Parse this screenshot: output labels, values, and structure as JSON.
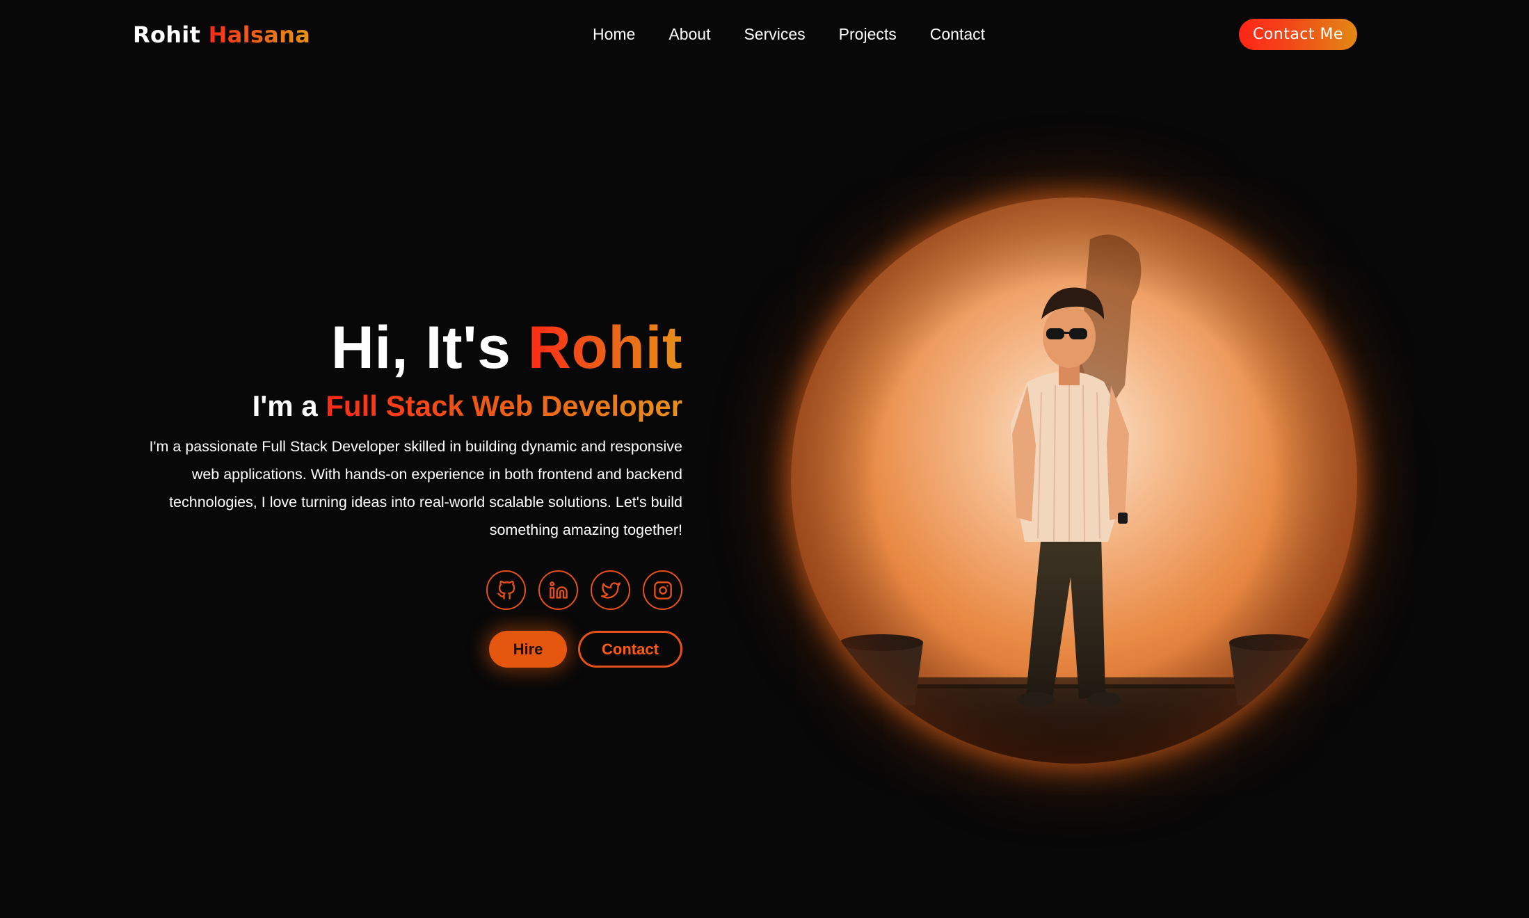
{
  "navbar": {
    "logo_first": "Rohit",
    "logo_last": "Halsana",
    "links": [
      {
        "label": "Home"
      },
      {
        "label": "About"
      },
      {
        "label": "Services"
      },
      {
        "label": "Projects"
      },
      {
        "label": "Contact"
      }
    ],
    "cta_label": "Contact Me"
  },
  "hero": {
    "greeting": "Hi, It's ",
    "name": "Rohit",
    "role_prefix": "I'm a ",
    "role": "Full Stack Web Developer",
    "description": "I'm a passionate Full Stack Developer skilled in building dynamic and responsive web applications. With hands-on experience in both frontend and backend technologies, I love turning ideas into real-world scalable solutions. Let's build something amazing together!",
    "socials": [
      {
        "icon": "github-icon"
      },
      {
        "icon": "linkedin-icon"
      },
      {
        "icon": "twitter-icon"
      },
      {
        "icon": "instagram-icon"
      }
    ],
    "hire_label": "Hire",
    "contact_label": "Contact"
  },
  "colors": {
    "background": "#080808",
    "accent": "#e5560f",
    "gradient_start": "#ff2a16",
    "gradient_end": "#e8901a",
    "text": "#ffffff"
  }
}
